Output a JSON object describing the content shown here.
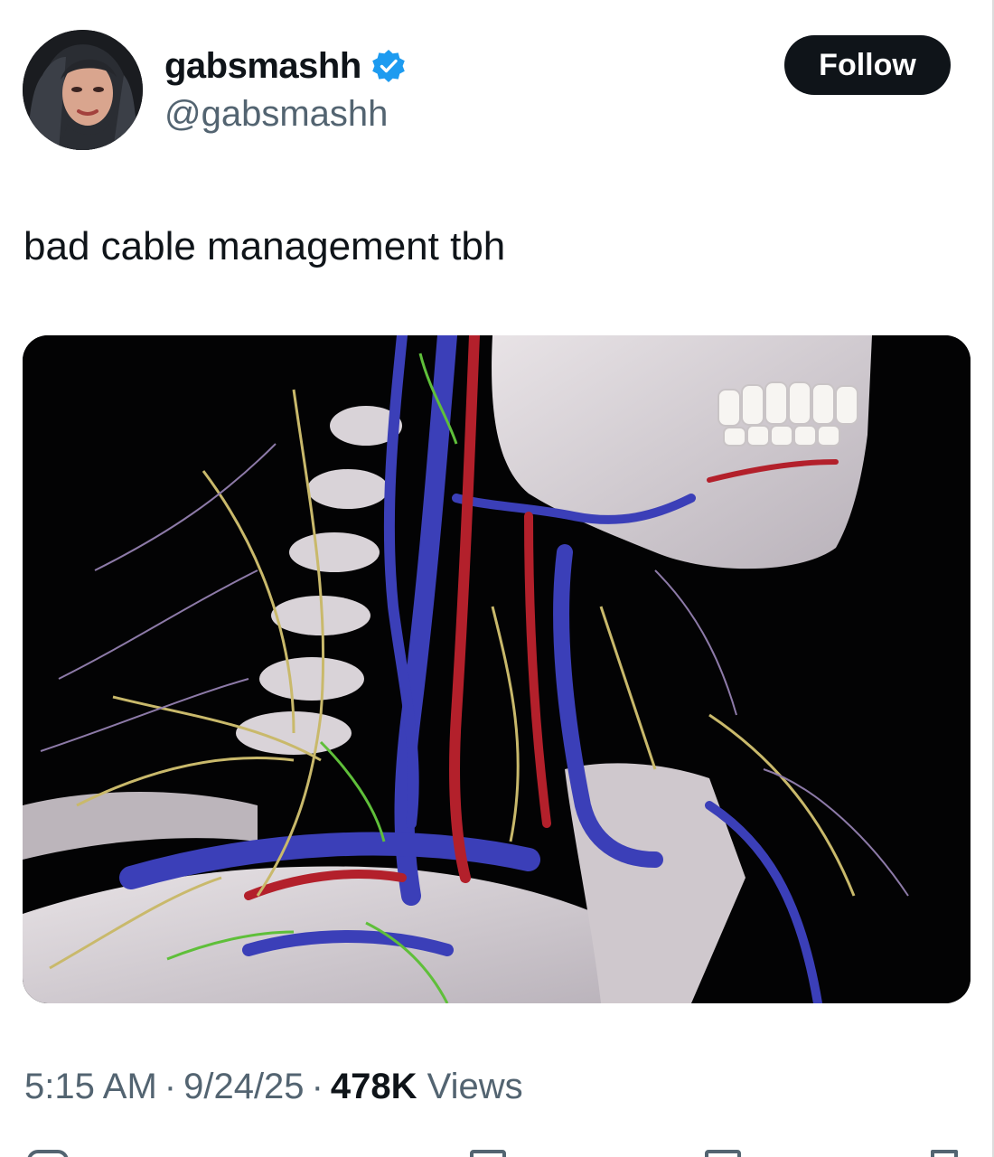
{
  "author": {
    "display_name": "gabsmashh",
    "handle": "@gabsmashh",
    "verified": true,
    "avatar_icon": "user-avatar"
  },
  "follow_button": {
    "label": "Follow"
  },
  "tweet": {
    "text": "bad cable management tbh"
  },
  "media": {
    "icon": "anatomy-image"
  },
  "meta": {
    "time": "5:15 AM",
    "date": "9/24/25",
    "views_count": "478K",
    "views_label": "Views",
    "separator": "·"
  },
  "colors": {
    "text_primary": "#0f1419",
    "text_secondary": "#536471",
    "verified_blue": "#1d9bf0",
    "follow_bg": "#0f1419"
  }
}
